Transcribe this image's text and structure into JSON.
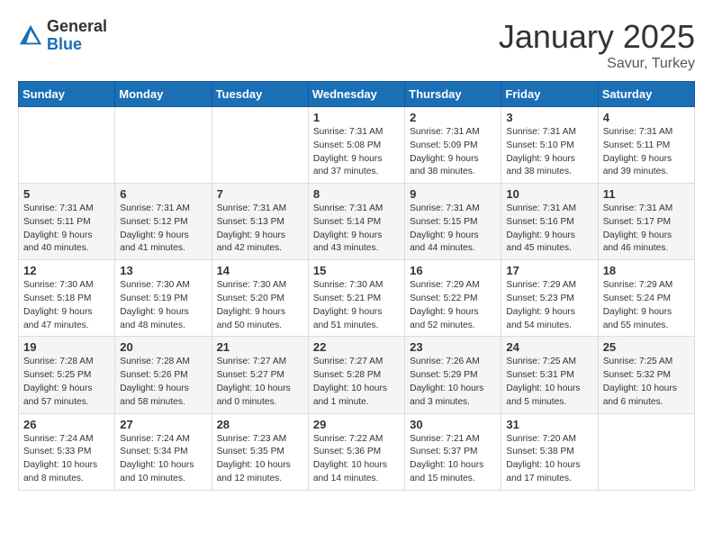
{
  "logo": {
    "general": "General",
    "blue": "Blue"
  },
  "header": {
    "month_year": "January 2025",
    "location": "Savur, Turkey"
  },
  "weekdays": [
    "Sunday",
    "Monday",
    "Tuesday",
    "Wednesday",
    "Thursday",
    "Friday",
    "Saturday"
  ],
  "weeks": [
    [
      {
        "day": "",
        "info": ""
      },
      {
        "day": "",
        "info": ""
      },
      {
        "day": "",
        "info": ""
      },
      {
        "day": "1",
        "info": "Sunrise: 7:31 AM\nSunset: 5:08 PM\nDaylight: 9 hours\nand 37 minutes."
      },
      {
        "day": "2",
        "info": "Sunrise: 7:31 AM\nSunset: 5:09 PM\nDaylight: 9 hours\nand 38 minutes."
      },
      {
        "day": "3",
        "info": "Sunrise: 7:31 AM\nSunset: 5:10 PM\nDaylight: 9 hours\nand 38 minutes."
      },
      {
        "day": "4",
        "info": "Sunrise: 7:31 AM\nSunset: 5:11 PM\nDaylight: 9 hours\nand 39 minutes."
      }
    ],
    [
      {
        "day": "5",
        "info": "Sunrise: 7:31 AM\nSunset: 5:11 PM\nDaylight: 9 hours\nand 40 minutes."
      },
      {
        "day": "6",
        "info": "Sunrise: 7:31 AM\nSunset: 5:12 PM\nDaylight: 9 hours\nand 41 minutes."
      },
      {
        "day": "7",
        "info": "Sunrise: 7:31 AM\nSunset: 5:13 PM\nDaylight: 9 hours\nand 42 minutes."
      },
      {
        "day": "8",
        "info": "Sunrise: 7:31 AM\nSunset: 5:14 PM\nDaylight: 9 hours\nand 43 minutes."
      },
      {
        "day": "9",
        "info": "Sunrise: 7:31 AM\nSunset: 5:15 PM\nDaylight: 9 hours\nand 44 minutes."
      },
      {
        "day": "10",
        "info": "Sunrise: 7:31 AM\nSunset: 5:16 PM\nDaylight: 9 hours\nand 45 minutes."
      },
      {
        "day": "11",
        "info": "Sunrise: 7:31 AM\nSunset: 5:17 PM\nDaylight: 9 hours\nand 46 minutes."
      }
    ],
    [
      {
        "day": "12",
        "info": "Sunrise: 7:30 AM\nSunset: 5:18 PM\nDaylight: 9 hours\nand 47 minutes."
      },
      {
        "day": "13",
        "info": "Sunrise: 7:30 AM\nSunset: 5:19 PM\nDaylight: 9 hours\nand 48 minutes."
      },
      {
        "day": "14",
        "info": "Sunrise: 7:30 AM\nSunset: 5:20 PM\nDaylight: 9 hours\nand 50 minutes."
      },
      {
        "day": "15",
        "info": "Sunrise: 7:30 AM\nSunset: 5:21 PM\nDaylight: 9 hours\nand 51 minutes."
      },
      {
        "day": "16",
        "info": "Sunrise: 7:29 AM\nSunset: 5:22 PM\nDaylight: 9 hours\nand 52 minutes."
      },
      {
        "day": "17",
        "info": "Sunrise: 7:29 AM\nSunset: 5:23 PM\nDaylight: 9 hours\nand 54 minutes."
      },
      {
        "day": "18",
        "info": "Sunrise: 7:29 AM\nSunset: 5:24 PM\nDaylight: 9 hours\nand 55 minutes."
      }
    ],
    [
      {
        "day": "19",
        "info": "Sunrise: 7:28 AM\nSunset: 5:25 PM\nDaylight: 9 hours\nand 57 minutes."
      },
      {
        "day": "20",
        "info": "Sunrise: 7:28 AM\nSunset: 5:26 PM\nDaylight: 9 hours\nand 58 minutes."
      },
      {
        "day": "21",
        "info": "Sunrise: 7:27 AM\nSunset: 5:27 PM\nDaylight: 10 hours\nand 0 minutes."
      },
      {
        "day": "22",
        "info": "Sunrise: 7:27 AM\nSunset: 5:28 PM\nDaylight: 10 hours\nand 1 minute."
      },
      {
        "day": "23",
        "info": "Sunrise: 7:26 AM\nSunset: 5:29 PM\nDaylight: 10 hours\nand 3 minutes."
      },
      {
        "day": "24",
        "info": "Sunrise: 7:25 AM\nSunset: 5:31 PM\nDaylight: 10 hours\nand 5 minutes."
      },
      {
        "day": "25",
        "info": "Sunrise: 7:25 AM\nSunset: 5:32 PM\nDaylight: 10 hours\nand 6 minutes."
      }
    ],
    [
      {
        "day": "26",
        "info": "Sunrise: 7:24 AM\nSunset: 5:33 PM\nDaylight: 10 hours\nand 8 minutes."
      },
      {
        "day": "27",
        "info": "Sunrise: 7:24 AM\nSunset: 5:34 PM\nDaylight: 10 hours\nand 10 minutes."
      },
      {
        "day": "28",
        "info": "Sunrise: 7:23 AM\nSunset: 5:35 PM\nDaylight: 10 hours\nand 12 minutes."
      },
      {
        "day": "29",
        "info": "Sunrise: 7:22 AM\nSunset: 5:36 PM\nDaylight: 10 hours\nand 14 minutes."
      },
      {
        "day": "30",
        "info": "Sunrise: 7:21 AM\nSunset: 5:37 PM\nDaylight: 10 hours\nand 15 minutes."
      },
      {
        "day": "31",
        "info": "Sunrise: 7:20 AM\nSunset: 5:38 PM\nDaylight: 10 hours\nand 17 minutes."
      },
      {
        "day": "",
        "info": ""
      }
    ]
  ]
}
